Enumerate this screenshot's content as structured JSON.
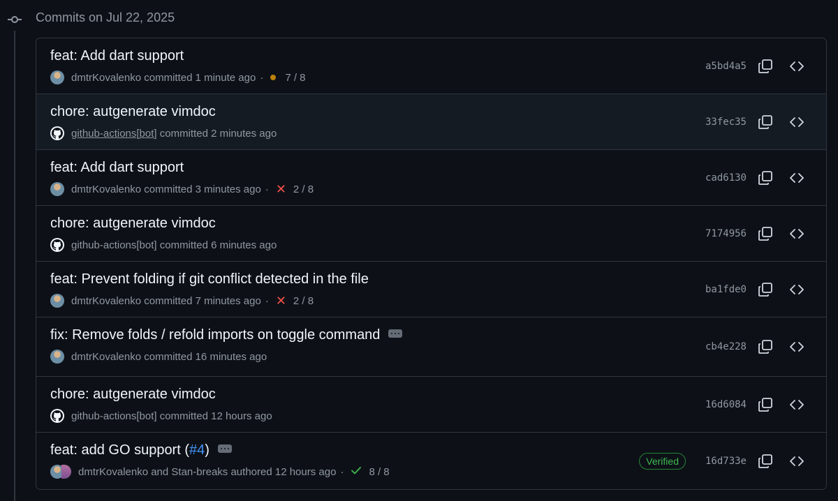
{
  "header": {
    "date_label": "Commits on Jul 22, 2025"
  },
  "commits": [
    {
      "title": "feat: Add dart support",
      "author": "dmtrKovalenko",
      "action": "committed",
      "time": "1 minute ago",
      "status": "pending",
      "checks": "7 / 8",
      "sha": "a5bd4a5",
      "avatar": "user",
      "pr": "",
      "has_ellipsis": false,
      "verified": "",
      "title_suffix": ""
    },
    {
      "title": "chore: autgenerate vimdoc",
      "author": "github-actions[bot]",
      "action": "committed",
      "time": "2 minutes ago",
      "status": "",
      "checks": "",
      "sha": "33fec35",
      "avatar": "bot",
      "pr": "",
      "has_ellipsis": false,
      "verified": "",
      "title_suffix": ""
    },
    {
      "title": "feat: Add dart support",
      "author": "dmtrKovalenko",
      "action": "committed",
      "time": "3 minutes ago",
      "status": "failure",
      "checks": "2 / 8",
      "sha": "cad6130",
      "avatar": "user",
      "pr": "",
      "has_ellipsis": false,
      "verified": "",
      "title_suffix": ""
    },
    {
      "title": "chore: autgenerate vimdoc",
      "author": "github-actions[bot]",
      "action": "committed",
      "time": "6 minutes ago",
      "status": "",
      "checks": "",
      "sha": "7174956",
      "avatar": "bot",
      "pr": "",
      "has_ellipsis": false,
      "verified": "",
      "title_suffix": ""
    },
    {
      "title": "feat: Prevent folding if git conflict detected in the file",
      "author": "dmtrKovalenko",
      "action": "committed",
      "time": "7 minutes ago",
      "status": "failure",
      "checks": "2 / 8",
      "sha": "ba1fde0",
      "avatar": "user",
      "pr": "",
      "has_ellipsis": false,
      "verified": "",
      "title_suffix": ""
    },
    {
      "title": "fix: Remove folds / refold imports on toggle command",
      "author": "dmtrKovalenko",
      "action": "committed",
      "time": "16 minutes ago",
      "status": "",
      "checks": "",
      "sha": "cb4e228",
      "avatar": "user",
      "pr": "",
      "has_ellipsis": true,
      "verified": "",
      "title_suffix": ""
    },
    {
      "title": "chore: autgenerate vimdoc",
      "author": "github-actions[bot]",
      "action": "committed",
      "time": "12 hours ago",
      "status": "",
      "checks": "",
      "sha": "16d6084",
      "avatar": "bot",
      "pr": "",
      "has_ellipsis": false,
      "verified": "",
      "title_suffix": ""
    },
    {
      "title": "feat: add GO support (",
      "author": "dmtrKovalenko and Stan-breaks",
      "action": "authored",
      "time": "12 hours ago",
      "status": "success",
      "checks": "8 / 8",
      "sha": "16d733e",
      "avatar": "pair",
      "pr": "#4",
      "has_ellipsis": true,
      "verified": "Verified",
      "title_suffix": ")"
    }
  ],
  "hover_row_index": 1,
  "icons": {
    "timeline": "git-commit-icon",
    "copy": "copy-icon",
    "browse": "code-browse-icon",
    "bot": "github-mark-icon",
    "pending": "pending-dot-icon",
    "failure": "x-icon",
    "success": "check-icon"
  },
  "colors": {
    "background": "#0d1117",
    "border": "#30363d",
    "muted_text": "#9198a1",
    "link": "#4493f8",
    "success": "#3fb950",
    "failure": "#f85149",
    "pending": "#bb8009"
  }
}
